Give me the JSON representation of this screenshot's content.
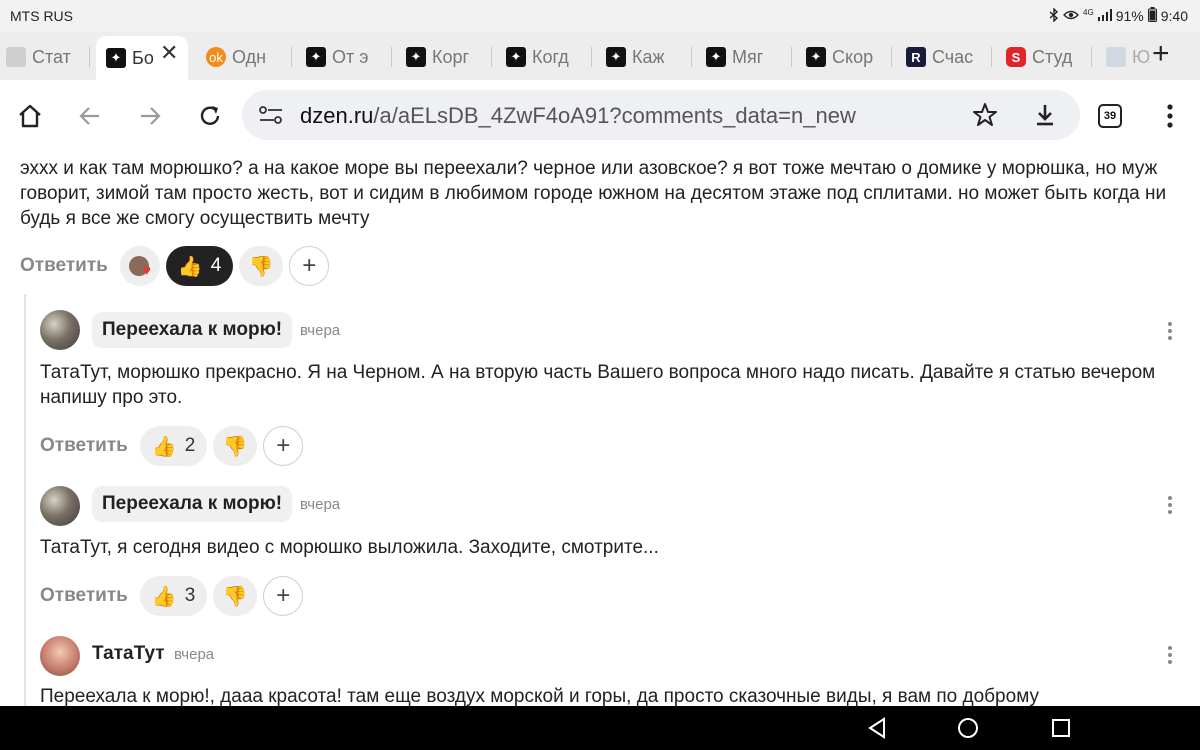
{
  "status": {
    "carrier": "MTS RUS",
    "icons": [
      "bluetooth-icon",
      "eye-icon",
      "signal-icon"
    ],
    "network": "4G",
    "battery": "91%",
    "time": "9:40"
  },
  "tabs": [
    {
      "label": "Стат",
      "icon": "gray"
    },
    {
      "label": "Бо",
      "icon": "dzen",
      "active": true
    },
    {
      "label": "Одн",
      "icon": "ok"
    },
    {
      "label": "От э",
      "icon": "dzen"
    },
    {
      "label": "Корг",
      "icon": "dzen"
    },
    {
      "label": "Когд",
      "icon": "dzen"
    },
    {
      "label": "Каж",
      "icon": "dzen"
    },
    {
      "label": "Мяг",
      "icon": "dzen"
    },
    {
      "label": "Скор",
      "icon": "dzen"
    },
    {
      "label": "Счас",
      "icon": "r"
    },
    {
      "label": "Студ",
      "icon": "s"
    },
    {
      "label": "Юл",
      "icon": "img"
    }
  ],
  "toolbar": {
    "url_host": "dzen.ru",
    "url_path": "/a/aELsDB_4ZwF4oA91?comments_data=n_new",
    "tab_count": "39"
  },
  "comments": {
    "top": {
      "text": "эххх и как там морюшко? а на какое море вы переехали? черное или азовское? я вот тоже мечтаю о домике у морюшка, но муж говорит, зимой там просто жесть, вот и сидим в любимом городе южном на десятом этаже под сплитами. но может быть когда ни будь я все же смогу осуществить мечту",
      "reply_label": "Ответить",
      "likes": "4"
    },
    "reply1": {
      "author": "Переехала к морю!",
      "time": "вчера",
      "text": "ТатаТут, морюшко прекрасно. Я на Черном. А на вторую часть Вашего вопроса много надо писать. Давайте я статью вечером напишу про это.",
      "reply_label": "Ответить",
      "likes": "2"
    },
    "reply2": {
      "author": "Переехала к морю!",
      "time": "вчера",
      "text": "ТатаТут, я сегодня видео с морюшко выложила. Заходите, смотрите...",
      "reply_label": "Ответить",
      "likes": "3"
    },
    "reply3": {
      "author": "ТатаТут",
      "time": "вчера",
      "text": "Переехала к морю!, дааа красота! там еще воздух морской и горы, да просто сказочные виды, я вам по доброму"
    }
  }
}
